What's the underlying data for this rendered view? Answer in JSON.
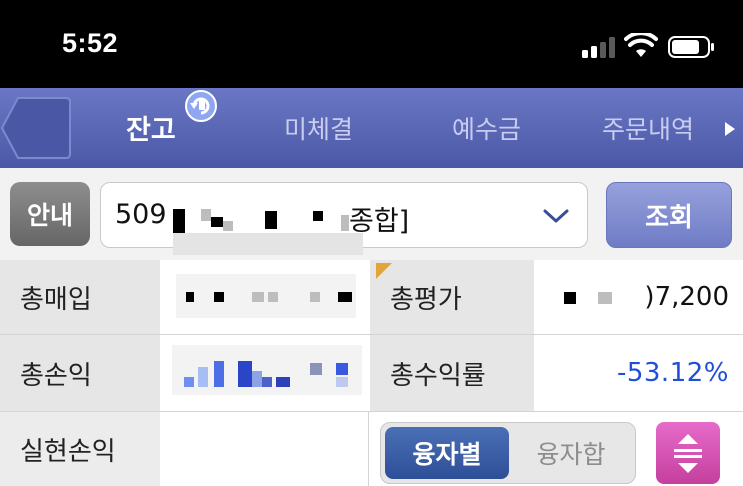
{
  "status_bar": {
    "time": "5:52"
  },
  "tabs": [
    {
      "label": "잔고"
    },
    {
      "label": "미체결"
    },
    {
      "label": "예수금"
    },
    {
      "label": "주문내역"
    }
  ],
  "account": {
    "guide_label": "안내",
    "number_prefix": "509",
    "type_suffix": "종합]",
    "search_label": "조회"
  },
  "summary": {
    "total_purchase_label": "총매입",
    "total_eval_label": "총평가",
    "total_eval_value": ")7,200",
    "total_pl_label": "총손익",
    "total_return_label": "총수익률",
    "total_return_value": "-53.12%",
    "realized_pl_label": "실현손익"
  },
  "toggle": {
    "by_loan": "융자별",
    "loan_sum": "융자합"
  },
  "colors": {
    "tab_bar": "#5865b3",
    "negative": "#1f4fd8",
    "sort_button": "#d553b2",
    "active_toggle": "#3a5ca6"
  }
}
